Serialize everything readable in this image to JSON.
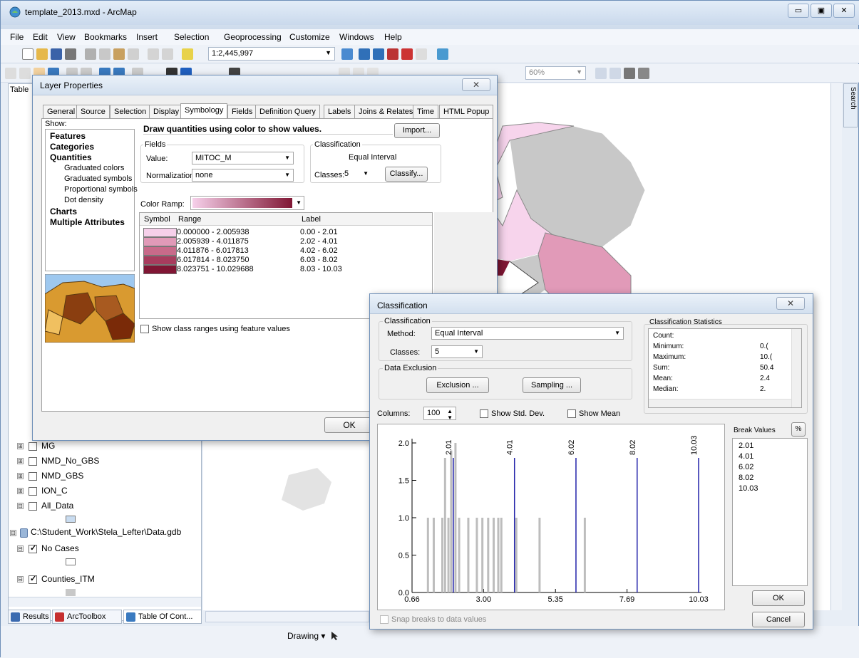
{
  "window": {
    "title": "template_2013.mxd - ArcMap",
    "minimize": "▭",
    "maximize": "▣",
    "close": "✕"
  },
  "menu": [
    "File",
    "Edit",
    "View",
    "Bookmarks",
    "Insert",
    "Selection",
    "Geoprocessing",
    "Customize",
    "Windows",
    "Help"
  ],
  "toolbar": {
    "scale": "1:2,445,997",
    "zoom": "60%"
  },
  "toc": {
    "header": "Table",
    "layers": [
      {
        "name": "MG",
        "checked": false,
        "plus": "⊞"
      },
      {
        "name": "NMD_No_GBS",
        "checked": false,
        "plus": "⊞"
      },
      {
        "name": "NMD_GBS",
        "checked": false,
        "plus": "⊞"
      },
      {
        "name": "ION_C",
        "checked": false,
        "plus": "⊞"
      },
      {
        "name": "All_Data",
        "checked": false,
        "plus": "⊟"
      }
    ],
    "gdb": "C:\\Student_Work\\Stela_Lefter\\Data.gdb",
    "gdb_layers": [
      {
        "name": "No Cases",
        "checked": true
      },
      {
        "name": "Counties_ITM",
        "checked": true
      }
    ]
  },
  "bottom_tabs": [
    "Results",
    "ArcToolbox",
    "Table Of Cont..."
  ],
  "drawing_toolbar": {
    "label": "Drawing ▾"
  },
  "layer_properties": {
    "title": "Layer Properties",
    "close": "✕",
    "tabs": [
      "General",
      "Source",
      "Selection",
      "Display",
      "Symbology",
      "Fields",
      "Definition Query",
      "Labels",
      "Joins & Relates",
      "Time",
      "HTML Popup"
    ],
    "active_tab": "Symbology",
    "show_label": "Show:",
    "show_items": [
      {
        "label": "Features",
        "bold": true,
        "indent": 0
      },
      {
        "label": "Categories",
        "bold": true,
        "indent": 0
      },
      {
        "label": "Quantities",
        "bold": true,
        "indent": 0
      },
      {
        "label": "Graduated colors",
        "bold": false,
        "indent": 1
      },
      {
        "label": "Graduated symbols",
        "bold": false,
        "indent": 1
      },
      {
        "label": "Proportional symbols",
        "bold": false,
        "indent": 1
      },
      {
        "label": "Dot density",
        "bold": false,
        "indent": 1
      },
      {
        "label": "Charts",
        "bold": true,
        "indent": 0
      },
      {
        "label": "Multiple Attributes",
        "bold": true,
        "indent": 0
      }
    ],
    "heading": "Draw quantities using color to show values.",
    "import_button": "Import...",
    "fields_group": "Fields",
    "value_label": "Value:",
    "value": "MITOC_M",
    "normalization_label": "Normalization:",
    "normalization": "none",
    "classification_group": "Classification",
    "method": "Equal Interval",
    "classes_label": "Classes:",
    "classes": "5",
    "classify_button": "Classify...",
    "color_ramp_label": "Color Ramp:",
    "table_headers": {
      "symbol": "Symbol",
      "range": "Range",
      "label": "Label"
    },
    "classes_rows": [
      {
        "range": "0.000000 - 2.005938",
        "label": "0.00 - 2.01",
        "color": "#f6d0ea"
      },
      {
        "range": "2.005939 - 4.011875",
        "label": "2.02 - 4.01",
        "color": "#e19ab8"
      },
      {
        "range": "4.011876 - 6.017813",
        "label": "4.02 - 6.02",
        "color": "#c86a8a"
      },
      {
        "range": "6.017814 - 8.023750",
        "label": "6.03 - 8.02",
        "color": "#a83c5e"
      },
      {
        "range": "8.023751 - 10.029688",
        "label": "8.03 - 10.03",
        "color": "#801634"
      }
    ],
    "show_ranges_label": "Show class ranges using feature values",
    "ok_button": "OK"
  },
  "classification": {
    "title": "Classification",
    "close": "✕",
    "group_classification": "Classification",
    "method_label": "Method:",
    "method": "Equal Interval",
    "classes_label": "Classes:",
    "classes": "5",
    "group_exclusion": "Data Exclusion",
    "exclusion_button": "Exclusion ...",
    "sampling_button": "Sampling ...",
    "stats_title": "Classification Statistics",
    "stats": [
      {
        "label": "Count:",
        "value": ""
      },
      {
        "label": "Minimum:",
        "value": "0.("
      },
      {
        "label": "Maximum:",
        "value": "10.("
      },
      {
        "label": "Sum:",
        "value": "50.4"
      },
      {
        "label": "Mean:",
        "value": "2.4"
      },
      {
        "label": "Median:",
        "value": "2."
      }
    ],
    "columns_label": "Columns:",
    "columns": "100",
    "show_std_label": "Show Std. Dev.",
    "show_mean_label": "Show Mean",
    "break_values_title": "Break Values",
    "percent_button": "%",
    "break_values": [
      "2.01",
      "4.01",
      "6.02",
      "8.02",
      "10.03"
    ],
    "ok_button": "OK",
    "cancel_button": "Cancel",
    "snap_label": "Snap breaks to data values"
  },
  "chart_data": {
    "type": "bar",
    "title": "",
    "xlabel": "",
    "ylabel": "",
    "xlim": [
      0.66,
      10.03
    ],
    "ylim": [
      0,
      2.0
    ],
    "x_ticks": [
      "0.66",
      "3.00",
      "5.35",
      "7.69",
      "10.03"
    ],
    "y_ticks": [
      "0.0",
      "0.5",
      "1.0",
      "1.5",
      "2.0"
    ],
    "histogram": {
      "x": [
        1.18,
        1.37,
        1.65,
        1.74,
        1.85,
        1.94,
        2.08,
        2.2,
        2.5,
        2.78,
        2.96,
        3.15,
        3.33,
        3.48,
        3.58,
        4.07,
        4.83,
        6.31
      ],
      "values": [
        1,
        1,
        1,
        1.8,
        1,
        1.9,
        2.0,
        1,
        1,
        1,
        1,
        1,
        1,
        1,
        1,
        1,
        1,
        1
      ]
    },
    "breaks": [
      2.01,
      4.01,
      6.02,
      8.02,
      10.03
    ],
    "break_labels": [
      "2.01",
      "4.01",
      "6.02",
      "8.02",
      "10.03"
    ],
    "grid": false,
    "colors": {
      "bars": "#bdbdbd",
      "breaks": "#2222aa"
    }
  }
}
